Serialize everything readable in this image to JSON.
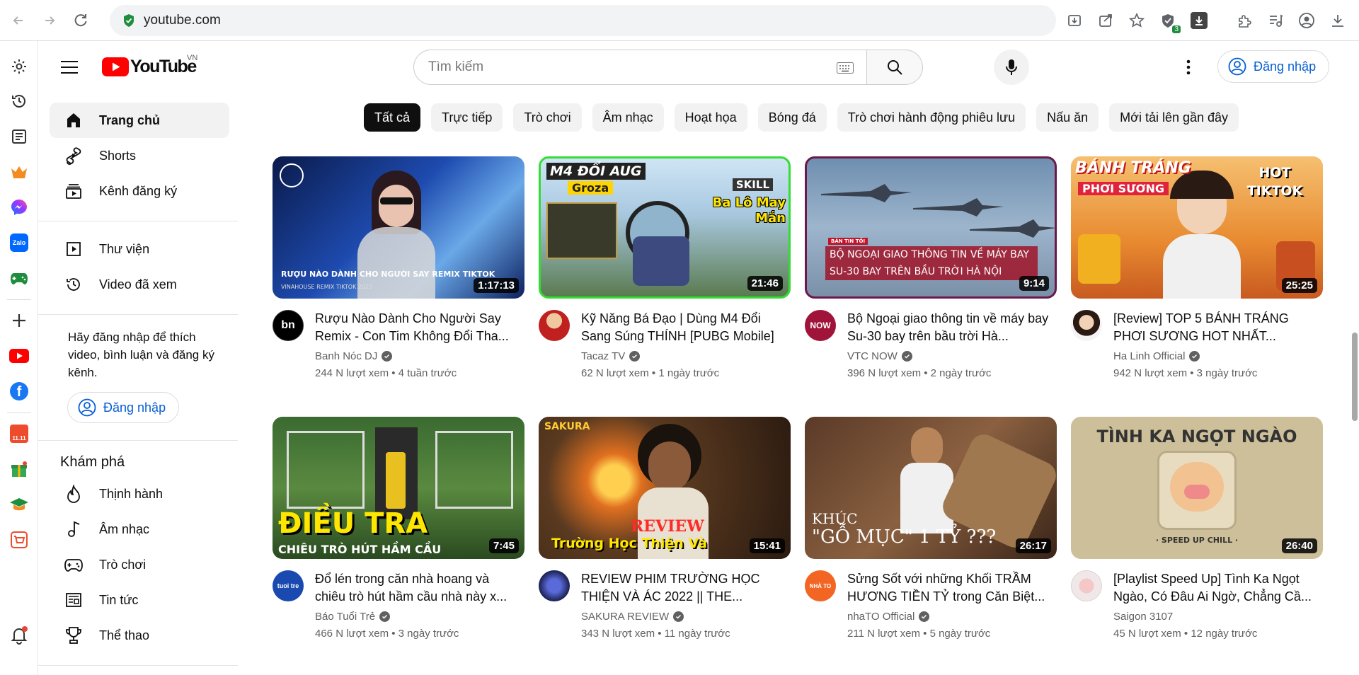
{
  "browser": {
    "url": "youtube.com",
    "shield_badge": "3"
  },
  "header": {
    "logo_text": "YouTube",
    "logo_country": "VN",
    "search_placeholder": "Tìm kiếm",
    "signin_label": "Đăng nhập",
    "accent": "#065fd4",
    "brand_red": "#ff0000"
  },
  "guide": {
    "items": [
      {
        "label": "Trang chủ",
        "icon": "home-icon"
      },
      {
        "label": "Shorts",
        "icon": "shorts-icon"
      },
      {
        "label": "Kênh đăng ký",
        "icon": "subscriptions-icon"
      }
    ],
    "library": [
      {
        "label": "Thư viện",
        "icon": "library-icon"
      },
      {
        "label": "Video đã xem",
        "icon": "history-icon"
      }
    ],
    "signin_prompt": "Hãy đăng nhập để thích video, bình luận và đăng ký kênh.",
    "signin_label": "Đăng nhập",
    "explore_title": "Khám phá",
    "explore": [
      {
        "label": "Thịnh hành",
        "icon": "trending-icon"
      },
      {
        "label": "Âm nhạc",
        "icon": "music-icon"
      },
      {
        "label": "Trò chơi",
        "icon": "gaming-icon"
      },
      {
        "label": "Tin tức",
        "icon": "news-icon"
      },
      {
        "label": "Thể thao",
        "icon": "sports-icon"
      }
    ]
  },
  "chips": [
    "Tất cả",
    "Trực tiếp",
    "Trò chơi",
    "Âm nhạc",
    "Hoạt họa",
    "Bóng đá",
    "Trò chơi hành động phiêu lưu",
    "Nấu ăn",
    "Mới tải lên gần đây"
  ],
  "videos": [
    {
      "title": "Rượu Nào Dành Cho Người Say Remix - Con Tim Không Đổi Tha...",
      "channel": "Banh Nóc DJ",
      "views": "244 N lượt xem",
      "age": "4 tuần trước",
      "duration": "1:17:13",
      "thumb_text": "RƯỢU NÀO DÀNH CHO NGƯỜI SAY REMIX TIKTOK",
      "thumb_sub": "VINAHOUSE REMIX TIKTOK 2023",
      "avatar_text": "bn"
    },
    {
      "title": "Kỹ Năng Bá Đạo | Dùng M4 Đổi Sang Súng THÍNH [PUBG Mobile]",
      "channel": "Tacaz TV",
      "views": "62 N lượt xem",
      "age": "1 ngày trước",
      "duration": "21:46",
      "thumb_text": "M4 ĐỔI AUG",
      "thumb_sub": "Groza",
      "thumb_extra": "SKILL",
      "thumb_extra2": "Ba Lô May Mắn",
      "avatar_text": ""
    },
    {
      "title": "Bộ Ngoại giao thông tin về máy bay Su-30 bay trên bầu trời Hà...",
      "channel": "VTC NOW",
      "views": "396 N lượt xem",
      "age": "2 ngày trước",
      "duration": "9:14",
      "thumb_text": "BỘ NGOẠI GIAO THÔNG TIN VỀ MÁY BAY SU-30 BAY TRÊN BẦU TRỜI HÀ NỘI",
      "thumb_sub": "BẢN TIN TỐI",
      "avatar_text": "NOW"
    },
    {
      "title": "[Review] TOP 5 BÁNH TRÁNG PHƠI SƯƠNG HOT NHẤT...",
      "channel": "Ha Linh Official",
      "views": "942 N lượt xem",
      "age": "3 ngày trước",
      "duration": "25:25",
      "thumb_text": "BÁNH TRÁNG",
      "thumb_sub": "PHƠI SƯƠNG",
      "thumb_extra": "HOT TIKTOK",
      "avatar_text": ""
    },
    {
      "title": "Đổ lén trong căn nhà hoang và chiêu trò hút hầm cầu nhà này x...",
      "channel": "Báo Tuổi Trẻ",
      "views": "466 N lượt xem",
      "age": "3 ngày trước",
      "duration": "7:45",
      "thumb_text": "ĐIỀU TRA",
      "thumb_sub": "CHIÊU TRÒ HÚT HẦM CẦU",
      "avatar_text": "tuoi tre"
    },
    {
      "title": "REVIEW PHIM TRƯỜNG HỌC THIỆN VÀ ÁC 2022 || THE...",
      "channel": "SAKURA REVIEW",
      "views": "343 N lượt xem",
      "age": "11 ngày trước",
      "duration": "15:41",
      "thumb_text": "REVIEW",
      "thumb_sub": "Trường Học Thiện Và",
      "thumb_extra": "SAKURA",
      "avatar_text": ""
    },
    {
      "title": "Sửng Sốt với những Khối TRẦM HƯƠNG TIỀN TỶ trong Căn Biệt...",
      "channel": "nhaTO Official",
      "views": "211 N lượt xem",
      "age": "5 ngày trước",
      "duration": "26:17",
      "thumb_text": "KHÚC",
      "thumb_sub": "\"GỖ MỤC\" 1 TỶ ???",
      "avatar_text": "NHÀ TO"
    },
    {
      "title": "[Playlist Speed Up] Tình Ka Ngọt Ngào, Có Đâu Ai Ngờ, Chẳng Cầ...",
      "channel": "Saigon 3107",
      "views": "45 N lượt xem",
      "age": "12 ngày trước",
      "duration": "26:40",
      "thumb_text": "TÌNH KA NGỌT NGÀO",
      "thumb_sub": "· SPEED UP CHILL ·",
      "avatar_text": ""
    }
  ]
}
